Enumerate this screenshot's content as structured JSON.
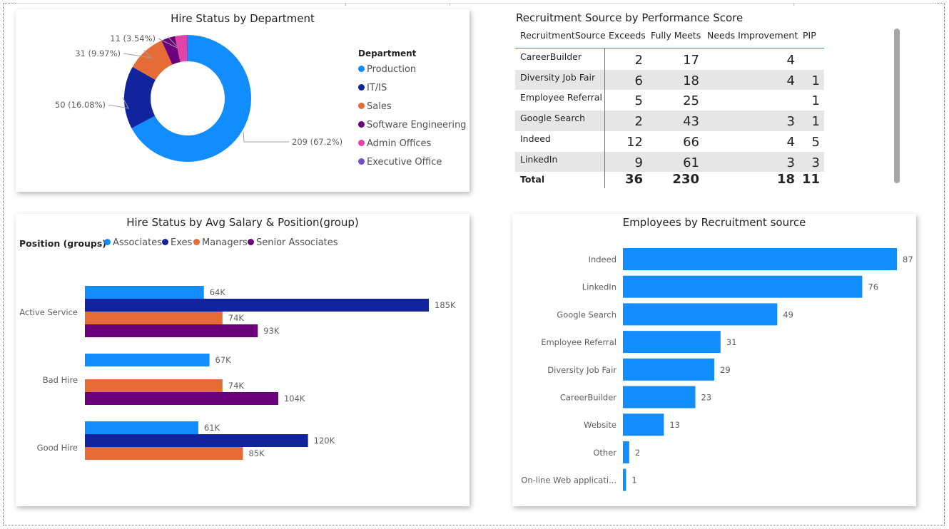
{
  "colors": {
    "associates": "#118DFF",
    "exes": "#12239E",
    "managers": "#E66C37",
    "senior_associates": "#6B007B",
    "production": "#118DFF",
    "itis": "#12239E",
    "sales": "#E66C37",
    "software_engineering": "#6B007B",
    "admin_offices": "#E044A7",
    "executive_office": "#744EC2",
    "bar": "#118DFF",
    "row_band": "#e6e6e6",
    "table_line": "#118DFF"
  },
  "chart_data": [
    {
      "type": "pie",
      "title": "Hire Status by Department",
      "legend_title": "Department",
      "legend_position": "right",
      "slices": [
        {
          "name": "Production",
          "value": 209,
          "label": "209 (67.2%)",
          "color_key": "production"
        },
        {
          "name": "IT/IS",
          "value": 50,
          "label": "50 (16.08%)",
          "color_key": "itis"
        },
        {
          "name": "Sales",
          "value": 31,
          "label": "31 (9.97%)",
          "color_key": "sales"
        },
        {
          "name": "Software Engineering",
          "value": 11,
          "label": "11 (3.54%)",
          "color_key": "software_engineering"
        },
        {
          "name": "Admin Offices",
          "value": 9,
          "label": "",
          "color_key": "admin_offices"
        },
        {
          "name": "Executive Office",
          "value": 1,
          "label": "",
          "color_key": "executive_office"
        }
      ]
    },
    {
      "type": "table",
      "title": "Recruitment Source by Performance Score",
      "columns": [
        "RecruitmentSource",
        "Exceeds",
        "Fully Meets",
        "Needs Improvement",
        "PIP"
      ],
      "rows": [
        [
          "CareerBuilder",
          "2",
          "17",
          "4",
          ""
        ],
        [
          "Diversity Job Fair",
          "6",
          "18",
          "4",
          "1"
        ],
        [
          "Employee Referral",
          "5",
          "25",
          "",
          "1"
        ],
        [
          "Google Search",
          "2",
          "43",
          "3",
          "1"
        ],
        [
          "Indeed",
          "12",
          "66",
          "4",
          "5"
        ],
        [
          "LinkedIn",
          "9",
          "61",
          "3",
          "3"
        ]
      ],
      "total": [
        "Total",
        "36",
        "230",
        "18",
        "11"
      ]
    },
    {
      "type": "bar",
      "orientation": "horizontal",
      "title": "Hire Status by Avg Salary & Position(group)",
      "legend_title": "Position (groups)",
      "legend_position": "top-left",
      "categories": [
        "Active Service",
        "Bad Hire",
        "Good Hire"
      ],
      "series": [
        {
          "name": "Associates",
          "color_key": "associates",
          "values": [
            64,
            67,
            61
          ],
          "labels": [
            "64K",
            "67K",
            "61K"
          ]
        },
        {
          "name": "Exes",
          "color_key": "exes",
          "values": [
            185,
            null,
            120
          ],
          "labels": [
            "185K",
            "",
            "120K"
          ]
        },
        {
          "name": "Managers",
          "color_key": "managers",
          "values": [
            74,
            74,
            85
          ],
          "labels": [
            "74K",
            "74K",
            "85K"
          ]
        },
        {
          "name": "Senior Associates",
          "color_key": "senior_associates",
          "values": [
            93,
            104,
            null
          ],
          "labels": [
            "93K",
            "104K",
            ""
          ]
        }
      ],
      "xlim": [
        0,
        185
      ]
    },
    {
      "type": "bar",
      "orientation": "horizontal",
      "title": "Employees by Recruitment source",
      "categories": [
        "Indeed",
        "LinkedIn",
        "Google Search",
        "Employee Referral",
        "Diversity Job Fair",
        "CareerBuilder",
        "Website",
        "Other",
        "On-line Web applicati..."
      ],
      "values": [
        87,
        76,
        49,
        31,
        29,
        23,
        13,
        2,
        1
      ],
      "xlim": [
        0,
        87
      ]
    }
  ]
}
